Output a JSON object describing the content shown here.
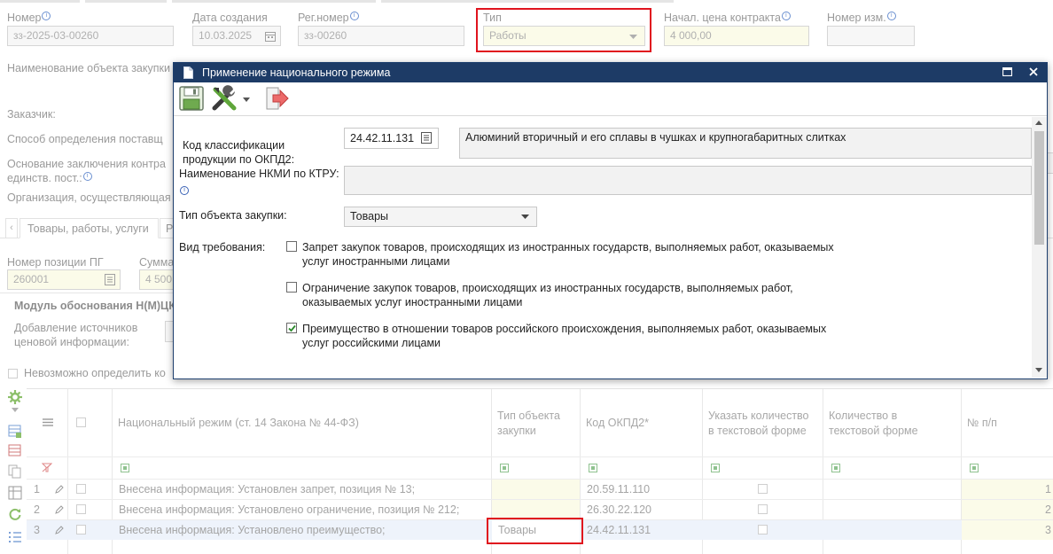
{
  "form": {
    "number": {
      "label": "Номер",
      "value": "зз-2025-03-00260"
    },
    "created": {
      "label": "Дата создания",
      "value": "10.03.2025"
    },
    "regnum": {
      "label": "Рег.номер",
      "value": "зз-00260"
    },
    "type": {
      "label": "Тип",
      "value": "Работы"
    },
    "start_price": {
      "label": "Начал. цена контракта",
      "value": "4 000,00"
    },
    "change_num": {
      "label": "Номер изм."
    },
    "object_name_label": "Наименование объекта закупки",
    "customer_label": "Заказчик:",
    "method_label": "Способ определения поставщ",
    "basis_label_1": "Основание заключения контра",
    "basis_label_2": "единств. пост.:",
    "org_label": "Организация, осуществляющая",
    "tab_goods": "Товары, работы, услуги",
    "tab_r": "Р",
    "pos_label": "Номер позиции ПГ",
    "pos_value": "260001",
    "sum_label": "Сумма",
    "sum_value": "4 500",
    "module_title": "Модуль обоснования Н(М)ЦК",
    "add_sources_1": "Добавление источников",
    "add_sources_2": "ценовой информации:",
    "impossible_label": "Невозможно определить ко"
  },
  "grid": {
    "headers": {
      "regime": "Национальный режим (ст. 14 Закона № 44-ФЗ)",
      "obj_type_1": "Тип объекта",
      "obj_type_2": "закупки",
      "okpd": "Код ОКПД2*",
      "qty_text_1": "Указать количество",
      "qty_text_2": "в текстовой форме",
      "qty_1": "Количество в",
      "qty_2": "текстовой форме",
      "num": "№ п/п"
    },
    "rows": [
      {
        "idx": "1",
        "regime": "Внесена информация: Установлен запрет, позиция № 13;",
        "obj_type": "",
        "okpd": "20.59.11.110",
        "num": "1"
      },
      {
        "idx": "2",
        "regime": "Внесена информация: Установлено ограничение, позиция № 212;",
        "obj_type": "",
        "okpd": "26.30.22.120",
        "num": "2"
      },
      {
        "idx": "3",
        "regime": "Внесена информация: Установлено преимущество;",
        "obj_type": "Товары",
        "okpd": "24.42.11.131",
        "num": "3"
      }
    ]
  },
  "dialog": {
    "title": "Применение национального режима",
    "okpd_label_1": "Код классификации",
    "okpd_label_2": "продукции по ОКПД2:",
    "okpd_value": "24.42.11.131",
    "okpd_desc": "Алюминий вторичный и его сплавы в чушках и крупногабаритных слитках",
    "nkmi_label": "Наименование НКМИ по КТРУ:",
    "obj_type_label": "Тип объекта закупки:",
    "obj_type_value": "Товары",
    "req_label": "Вид требования:",
    "opt1_1": "Запрет закупок товаров, происходящих из иностранных государств, выполняемых работ, оказываемых",
    "opt1_2": "услуг иностранными лицами",
    "opt2_1": "Ограничение закупок товаров, происходящих из иностранных государств, выполняемых работ,",
    "opt2_2": "оказываемых услуг иностранными лицами",
    "opt3_1": "Преимущество в отношении товаров российского происхождения, выполняемых работ, оказываемых",
    "opt3_2": "услуг российскими лицами"
  },
  "colors": {
    "dialog_title_bg": "#1d3b66",
    "highlight": "#e0141e",
    "checkmark": "#2b8a2b"
  }
}
